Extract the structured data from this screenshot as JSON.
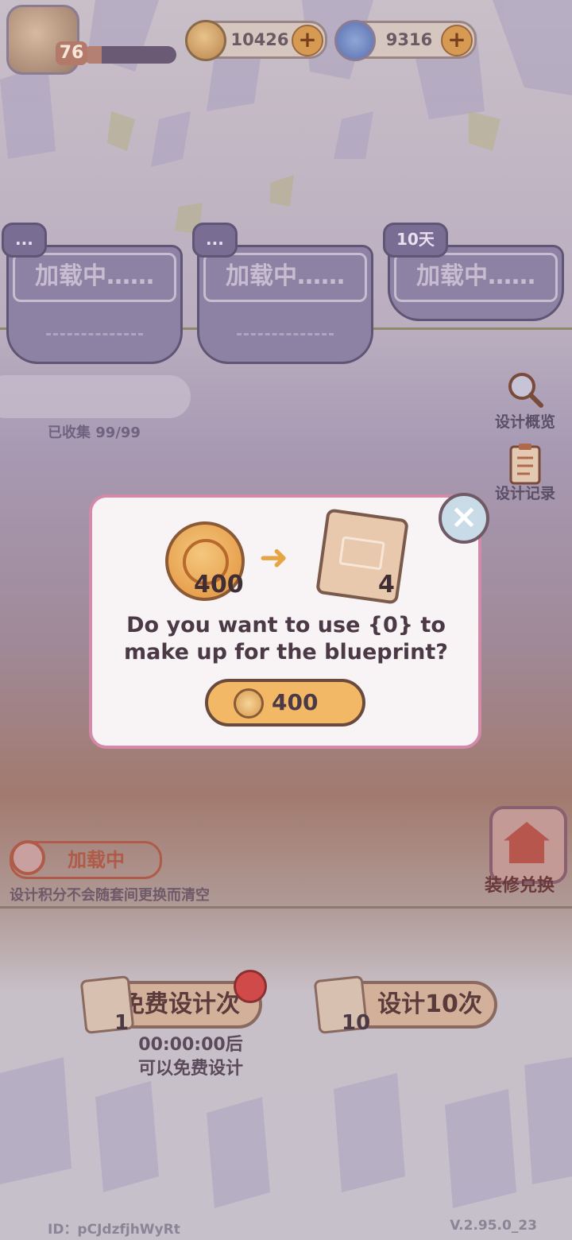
{
  "topbar": {
    "level": "76",
    "xp_fraction": 0.2,
    "coins": "10426",
    "gems": "9316",
    "plus_label": "+"
  },
  "slots": [
    {
      "tag": "...",
      "status": "加载中……"
    },
    {
      "tag": "...",
      "status": "加载中……"
    },
    {
      "tag": "10天",
      "status": "加载中……"
    }
  ],
  "collected": "已收集 99/99",
  "side": {
    "overview": "设计概览",
    "records": "设计记录",
    "renovation": "装修兑换"
  },
  "modal": {
    "cost_amount": "400",
    "blueprint_amount": "4",
    "question": "Do you want to use {0} to make up for the blueprint?",
    "buy_price": "400",
    "close_icon": "×"
  },
  "bottom": {
    "loading_label": "加载中",
    "note": "设计积分不会随套间更换而清空",
    "free_button": "免费设计次",
    "free_count": "1",
    "ten_button": "设计10次",
    "ten_count": "10",
    "timer_line1": "00:00:00后",
    "timer_line2": "可以免费设计"
  },
  "footer": {
    "id": "ID：pCJdzfjhWyRt",
    "version": "V.2.95.0_23"
  },
  "colors": {
    "modal_border": "#d28aa8",
    "gold_button": "#f2b866",
    "slot_purple": "#8e82a4"
  }
}
